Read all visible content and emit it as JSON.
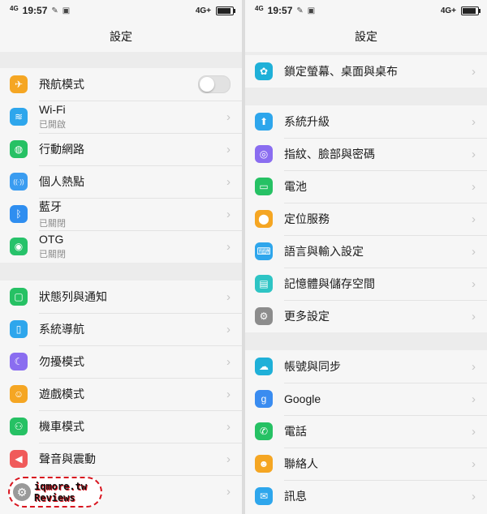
{
  "status_bar": {
    "network": "4G",
    "time": "19:57",
    "right_network": "4G+"
  },
  "title": "設定",
  "left_panel": {
    "groups": [
      [
        {
          "label": "飛航模式",
          "icon": "airplane-icon",
          "color": "#f5a623",
          "type": "toggle"
        },
        {
          "label": "Wi-Fi",
          "sub": "已開啟",
          "icon": "wifi-icon",
          "color": "#2ea6ec"
        },
        {
          "label": "行動網路",
          "icon": "globe-icon",
          "color": "#26c164"
        },
        {
          "label": "個人熱點",
          "icon": "hotspot-icon",
          "color": "#3a9cf0"
        },
        {
          "label": "藍牙",
          "sub": "已關閉",
          "icon": "bluetooth-icon",
          "color": "#2f8ef0"
        },
        {
          "label": "OTG",
          "sub": "已關閉",
          "icon": "otg-icon",
          "color": "#27c26a"
        }
      ],
      [
        {
          "label": "狀態列與通知",
          "icon": "notification-icon",
          "color": "#26c164"
        },
        {
          "label": "系統導航",
          "icon": "navigation-icon",
          "color": "#2ea6ec"
        },
        {
          "label": "勿擾模式",
          "icon": "moon-icon",
          "color": "#8a6df0"
        },
        {
          "label": "遊戲模式",
          "icon": "gamepad-icon",
          "color": "#f5a623"
        },
        {
          "label": "機車模式",
          "icon": "motorbike-icon",
          "color": "#26c164"
        },
        {
          "label": "聲音與震動",
          "icon": "speaker-icon",
          "color": "#f05a5a"
        },
        {
          "label": "…度",
          "icon": "brightness-icon",
          "color": "#f5a623"
        }
      ]
    ]
  },
  "right_panel": {
    "groups": [
      [
        {
          "label": "鎖定螢幕、桌面與桌布",
          "icon": "palette-icon",
          "color": "#1fb0d8"
        }
      ],
      [
        {
          "label": "系統升級",
          "icon": "update-icon",
          "color": "#2ea6ec"
        },
        {
          "label": "指紋、臉部與密碼",
          "icon": "fingerprint-icon",
          "color": "#8a6df0"
        },
        {
          "label": "電池",
          "icon": "battery-icon",
          "color": "#26c164"
        },
        {
          "label": "定位服務",
          "icon": "location-icon",
          "color": "#f5a623"
        },
        {
          "label": "語言與輸入設定",
          "icon": "keyboard-icon",
          "color": "#2ea6ec"
        },
        {
          "label": "記憶體與儲存空間",
          "icon": "storage-icon",
          "color": "#2ec4c4"
        },
        {
          "label": "更多設定",
          "icon": "more-settings-icon",
          "color": "#8c8c8c"
        }
      ],
      [
        {
          "label": "帳號與同步",
          "icon": "cloud-icon",
          "color": "#1fb0d8"
        },
        {
          "label": "Google",
          "icon": "google-icon",
          "color": "#3a8cf0"
        },
        {
          "label": "電話",
          "icon": "phone-icon",
          "color": "#26c164"
        },
        {
          "label": "聯絡人",
          "icon": "contacts-icon",
          "color": "#f5a623"
        },
        {
          "label": "訊息",
          "icon": "message-icon",
          "color": "#2ea6ec"
        }
      ]
    ]
  },
  "watermark": {
    "line1": "iqmore.tw",
    "line2": "Reviews"
  }
}
